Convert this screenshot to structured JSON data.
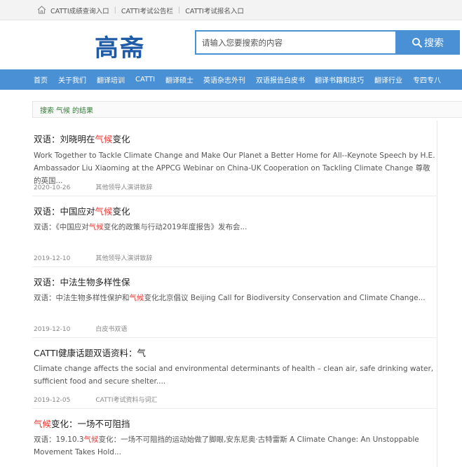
{
  "topbar": {
    "links": [
      "CATTI成绩查询入口",
      "CATTI考试公告栏",
      "CATTI考试报名入口"
    ],
    "separator": "|",
    "home_icon": "home-icon"
  },
  "header": {
    "logo": "高斋",
    "search_placeholder": "请输入您要搜索的内容",
    "search_button": "搜索",
    "search_icon": "search-icon"
  },
  "nav": [
    "首页",
    "关于我们",
    "翻译培训",
    "CATTI",
    "翻译硕士",
    "英语杂志外刊",
    "双语报告白皮书",
    "翻译书籍和技巧",
    "翻译行业",
    "专四专八"
  ],
  "results_header": {
    "prefix": "搜索",
    "keyword": "气候",
    "suffix": "的结果"
  },
  "results": [
    {
      "title_pre": "双语：刘晓明在",
      "title_hl": "气候",
      "title_post": "变化",
      "summary_pre": "Work Together to Tackle Climate Change and Make Our Planet a Better Home for All--Keynote Speech by H.E. Ambassador Liu Xiaoming at the APPCG Webinar on China-UK Cooperation on Tackling Climate Change 尊敬的英国...",
      "summary_hl": "",
      "summary_post": "",
      "date": "2020-10-26",
      "category": "其他领导人演讲致辞"
    },
    {
      "title_pre": "双语：中国应对",
      "title_hl": "气候",
      "title_post": "变化",
      "summary_pre": "双语：《中国应对",
      "summary_hl": "气候",
      "summary_post": "变化的政策与行动2019年度报告》发布会...",
      "date": "2019-12-10",
      "category": "其他领导人演讲致辞"
    },
    {
      "title_pre": "双语：中法生物多样性保",
      "title_hl": "",
      "title_post": "",
      "summary_pre": "双语：中法生物多样性保护和",
      "summary_hl": "气候",
      "summary_post": "变化北京倡议 Beijing Call for Biodiversity Conservation and Climate Change...",
      "date": "2019-12-10",
      "category": "白皮书双语"
    },
    {
      "title_pre": "CATTI健康话题双语资料：气",
      "title_hl": "",
      "title_post": "",
      "summary_pre": "Climate change affects the social and environmental determinants of health – clean air, safe drinking water, sufficient food and secure shelter....",
      "summary_hl": "",
      "summary_post": "",
      "date": "2019-12-05",
      "category": "CATTI考试资料与词汇"
    },
    {
      "title_pre": "",
      "title_hl": "气候",
      "title_post": "变化：一场不可阻挡",
      "summary_pre": "双语：19.10.3",
      "summary_hl": "气候",
      "summary_post": "变化：一场不可阻挡的运动始做了脚眼,安东尼奥·古特雷斯 A Climate Change: An Unstoppable Movement Takes Hold...",
      "date": "",
      "category": ""
    }
  ]
}
